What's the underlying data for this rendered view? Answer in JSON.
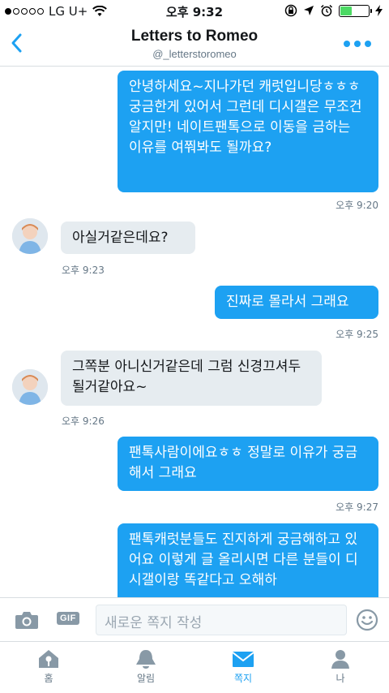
{
  "status": {
    "carrier": "LG U+",
    "time": "오후 9:32"
  },
  "header": {
    "title": "Letters to Romeo",
    "handle": "@_letterstoromeo"
  },
  "messages": [
    {
      "text": "안녕하세요~지나가던 캐럿입니당ㅎㅎㅎ 궁금한게 있어서 그런데 디시갤은 무조건 알지만! 네이트팬톡으로 이동을 금하는 이유를 여쭤봐도 될까요?",
      "time": "오후 9:20"
    },
    {
      "text": "아실거같은데요?",
      "time": "오후 9:23"
    },
    {
      "text": "진짜로 몰라서 그래요",
      "time": "오후 9:25"
    },
    {
      "text": "그쪽분 아니신거같은데 그럼 신경끄셔두 될거같아요~",
      "time": "오후 9:26"
    },
    {
      "text": "팬톡사람이에요ㅎㅎ 정말로 이유가 궁금해서 그래요",
      "time": "오후 9:27"
    },
    {
      "text": "팬톡캐럿분들도 진지하게 궁금해하고 있어요 이렇게 글 올리시면 다른 분들이 디시갤이랑 똑같다고 오해하"
    }
  ],
  "composer": {
    "gif_label": "GIF",
    "placeholder": "새로운 쪽지 작성"
  },
  "tabs": [
    {
      "label": "홈",
      "icon": "home-icon"
    },
    {
      "label": "알림",
      "icon": "bell-icon"
    },
    {
      "label": "쪽지",
      "icon": "envelope-icon"
    },
    {
      "label": "나",
      "icon": "person-icon"
    }
  ],
  "colors": {
    "accent": "#1da1f2",
    "incoming_bubble": "#e6ecf0",
    "muted": "#657786"
  }
}
